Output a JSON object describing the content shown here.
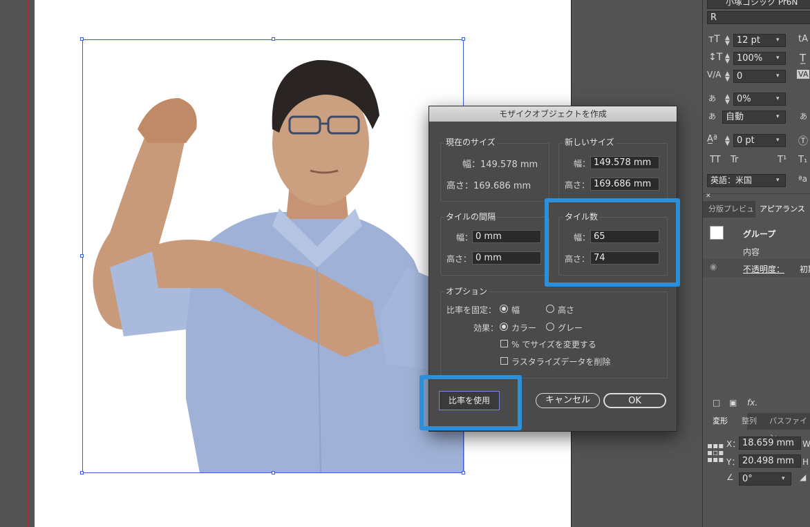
{
  "dialog": {
    "title": "モザイクオブジェクトを作成",
    "current_size": {
      "title": "現在のサイズ",
      "width_label": "幅：149.578 mm",
      "height_label": "高さ：169.686 mm"
    },
    "new_size": {
      "title": "新しいサイズ",
      "width_label": "幅：",
      "width_value": "149.578 mm",
      "height_label": "高さ：",
      "height_value": "169.686 mm"
    },
    "tile_spacing": {
      "title": "タイルの間隔",
      "width_label": "幅：",
      "width_value": "0 mm",
      "height_label": "高さ：",
      "height_value": "0 mm"
    },
    "tile_count": {
      "title": "タイル数",
      "width_label": "幅：",
      "width_value": "65",
      "height_label": "高さ：",
      "height_value": "74"
    },
    "options": {
      "title": "オプション",
      "constrain_label": "比率を固定：",
      "constrain_width": "幅",
      "constrain_height": "高さ",
      "effect_label": "効果：",
      "effect_color": "カラー",
      "effect_gray": "グレー",
      "percent_resize": "% でサイズを変更する",
      "delete_raster": "ラスタライズデータを削除"
    },
    "use_ratio_button": "比率を使用",
    "cancel_button": "キャンセル",
    "ok_button": "OK",
    "highlight_color": "#2b8fdc"
  },
  "character_panel": {
    "font_family": "小塚ゴシック Pr6N",
    "font_style": "R",
    "font_size": "12 pt",
    "leading_icon_label": "tA",
    "vertical_scale": "100%",
    "kerning": "0",
    "tsume": "0%",
    "aki": "自動",
    "baseline_shift": "0 pt",
    "language": "英語：米国",
    "tt_label": "TT",
    "tr_label": "Tr",
    "t1_label": "T¹",
    "t2_label": "T₁",
    "aa_label": "ªa",
    "tracking_icon_label": "VA"
  },
  "appearance_panel": {
    "tab_pagination": "分版プレビュ",
    "tab_appearance": "アピアランス",
    "group_label": "グループ",
    "contents_label": "内容",
    "opacity_label": "不透明度：",
    "opacity_value": "初期",
    "fx_label": "fx."
  },
  "transform_panel": {
    "tab_transform": "変形",
    "tab_align": "整列",
    "tab_pathfinder": "パスファイン",
    "x_label": "X：",
    "x_value": "18.659 mm",
    "w_label": "W：",
    "y_label": "Y：",
    "y_value": "20.498 mm",
    "h_label": "H：",
    "angle_value": "0°"
  }
}
